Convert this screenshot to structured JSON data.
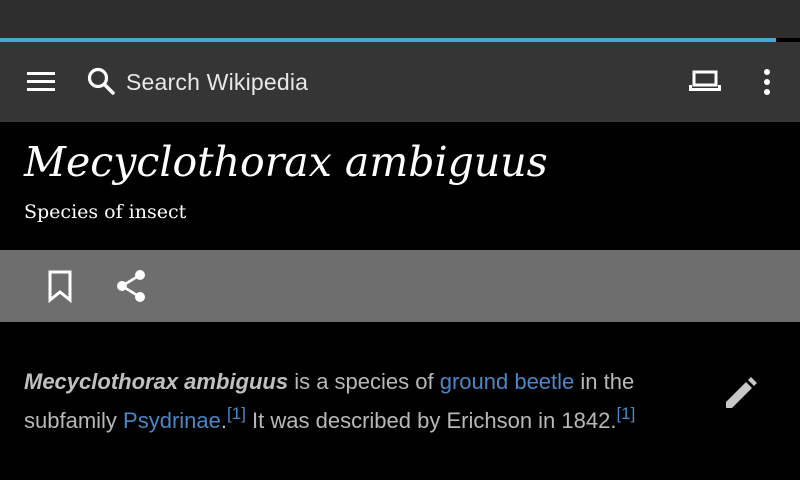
{
  "toolbar": {
    "search_placeholder": "Search Wikipedia",
    "icons": [
      "menu-icon",
      "search-icon",
      "tabs-icon",
      "overflow-menu-icon"
    ]
  },
  "progress": {
    "fraction": 0.97,
    "color": "#45a7d2"
  },
  "article": {
    "title": "Mecyclothorax ambiguus",
    "description": "Species of insect",
    "actions": [
      "bookmark-icon",
      "share-icon"
    ],
    "lead": {
      "term": "Mecyclothorax ambiguus",
      "text1": " is a species of ",
      "link1": "ground beetle",
      "text2": " in the subfamily ",
      "link2": "Psydrinae",
      "text3": ".",
      "ref1": "[1]",
      "text4": " It was described by Erichson in 1842.",
      "ref2": "[1]"
    },
    "edit_icon": "pencil-icon"
  },
  "colors": {
    "toolbar_bg": "#353535",
    "action_bar_bg": "#6e6e6e",
    "link": "#4b86c6",
    "body_text": "#b8b8b8"
  }
}
